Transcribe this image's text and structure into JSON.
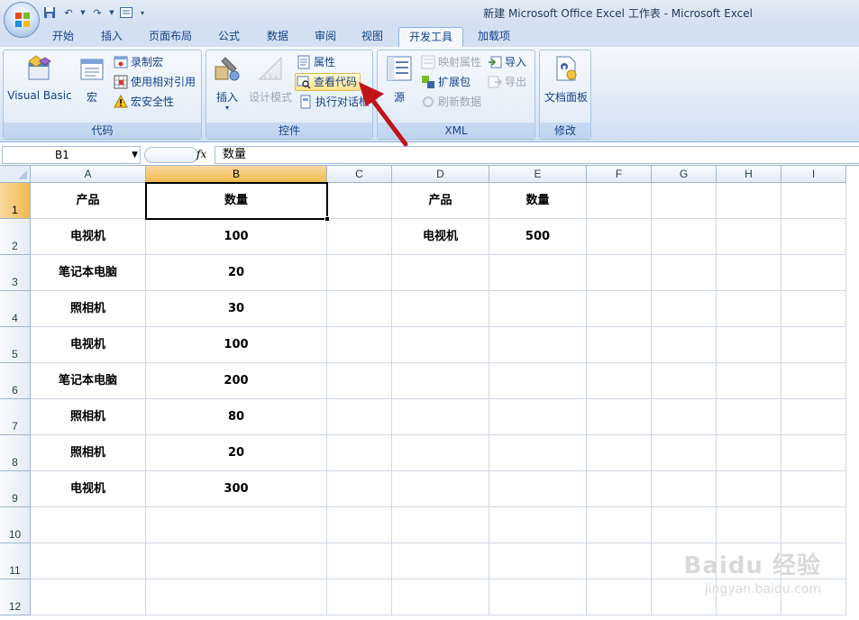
{
  "window": {
    "title": "新建 Microsoft Office Excel 工作表 - Microsoft Excel"
  },
  "ribbon_tabs": [
    "开始",
    "插入",
    "页面布局",
    "公式",
    "数据",
    "审阅",
    "视图",
    "开发工具",
    "加载项"
  ],
  "active_tab": "开发工具",
  "groups": {
    "code": {
      "label": "代码",
      "visual_basic": "Visual Basic",
      "macro": "宏",
      "record_macro": "录制宏",
      "relative_ref": "使用相对引用",
      "macro_security": "宏安全性"
    },
    "controls": {
      "label": "控件",
      "insert": "插入",
      "design_mode": "设计模式",
      "properties": "属性",
      "view_code": "查看代码",
      "run_dialog": "执行对话框"
    },
    "xml": {
      "label": "XML",
      "source": "源",
      "map_properties": "映射属性",
      "expansion_pack": "扩展包",
      "refresh_data": "刷新数据",
      "import": "导入",
      "export": "导出"
    },
    "modify": {
      "label": "修改",
      "doc_panel": "文档面板"
    }
  },
  "name_box": "B1",
  "formula_fx": "fx",
  "formula_value": "数量",
  "columns": [
    "A",
    "B",
    "C",
    "D",
    "E",
    "F",
    "G",
    "H",
    "I"
  ],
  "rows": [
    "1",
    "2",
    "3",
    "4",
    "5",
    "6",
    "7",
    "8",
    "9",
    "10",
    "11",
    "12"
  ],
  "selected_cell": "B1",
  "cells": {
    "A": [
      "产品",
      "电视机",
      "笔记本电脑",
      "照相机",
      "电视机",
      "笔记本电脑",
      "照相机",
      "照相机",
      "电视机"
    ],
    "B": [
      "数量",
      "100",
      "20",
      "30",
      "100",
      "200",
      "80",
      "20",
      "300"
    ],
    "D": [
      "产品",
      "电视机"
    ],
    "E": [
      "数量",
      "500"
    ]
  },
  "watermark": {
    "logo_text": "Baidu 经验",
    "url": "jingyan.baidu.com"
  },
  "colors": {
    "accent_arrow": "#c0141b",
    "selection_header": "#f1b94e",
    "ribbon_text": "#15428b"
  }
}
